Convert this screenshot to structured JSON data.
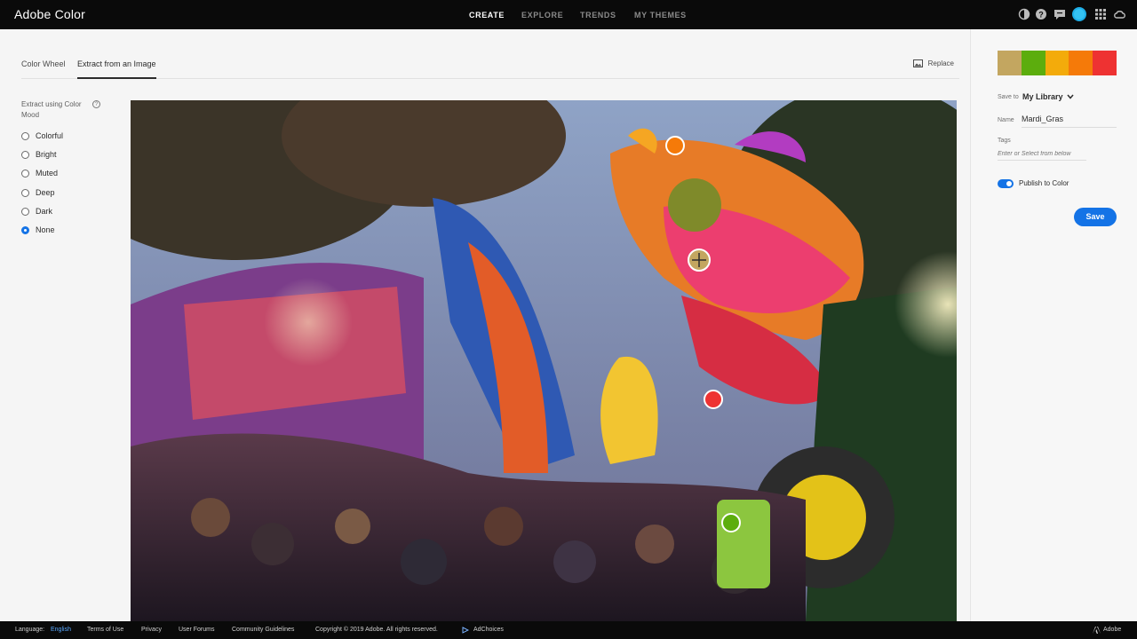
{
  "app": {
    "title": "Adobe Color"
  },
  "nav": {
    "items": [
      "CREATE",
      "EXPLORE",
      "TRENDS",
      "MY THEMES"
    ],
    "active": "CREATE"
  },
  "topbar_icons": [
    "theme-icon",
    "help-icon",
    "feedback-icon",
    "avatar",
    "apps-grid-icon",
    "creative-cloud-icon"
  ],
  "tabs": [
    "Color Wheel",
    "Extract from an Image"
  ],
  "replace_label": "Replace",
  "mood": {
    "title": "Extract using Color Mood",
    "options": [
      "Colorful",
      "Bright",
      "Muted",
      "Deep",
      "Dark",
      "None"
    ],
    "selected": "None"
  },
  "theme": {
    "swatches": [
      "#c3a660",
      "#5cad0d",
      "#f3ab0b",
      "#f57a09",
      "#ee3232"
    ],
    "save_to_label": "Save to",
    "save_to_value": "My Library",
    "name_label": "Name",
    "name_value": "Mardi_Gras",
    "tags_label": "Tags",
    "tags_placeholder": "Enter or Select from below",
    "publish_label": "Publish to Color",
    "publish_on": true,
    "save_label": "Save"
  },
  "footer": {
    "language_label": "Language:",
    "language_value": "English",
    "links": [
      "Terms of Use",
      "Privacy",
      "User Forums",
      "Community Guidelines"
    ],
    "copyright": "Copyright © 2019 Adobe. All rights reserved.",
    "adchoices": "AdChoices",
    "brand": "Adobe"
  },
  "colors": {
    "accent": "#1473e6",
    "topbar": "#0a0a0a"
  }
}
